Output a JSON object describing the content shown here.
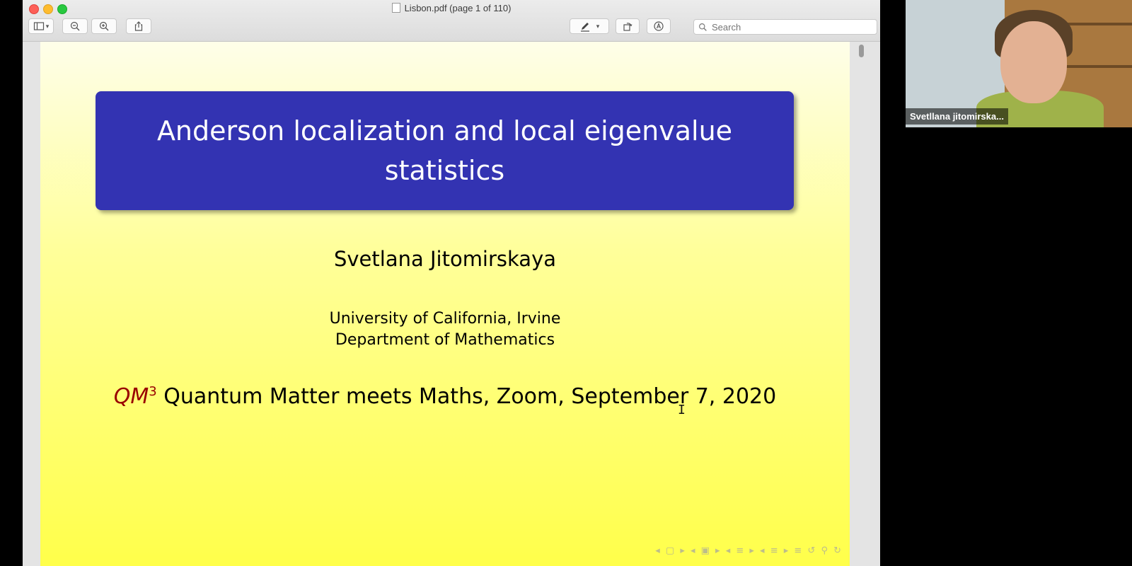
{
  "window": {
    "title": "Lisbon.pdf (page 1 of 110)"
  },
  "toolbar": {
    "search_placeholder": "Search"
  },
  "slide": {
    "title": "Anderson localization and local eigenvalue statistics",
    "author": "Svetlana Jitomirskaya",
    "affiliation_1": "University of California, Irvine",
    "affiliation_2": "Department of Mathematics",
    "event_prefix": "QM",
    "event_sup": "3",
    "event_text": " Quantum Matter meets Maths, Zoom, September 7, 2020",
    "nav_glyphs": "◂ ▢ ▸ ◂ ▣ ▸ ◂ ≡ ▸ ◂ ≡ ▸   ≡   ↺ ⚲ ↻"
  },
  "webcam": {
    "participant_name": "Svetllana jitomirska..."
  }
}
